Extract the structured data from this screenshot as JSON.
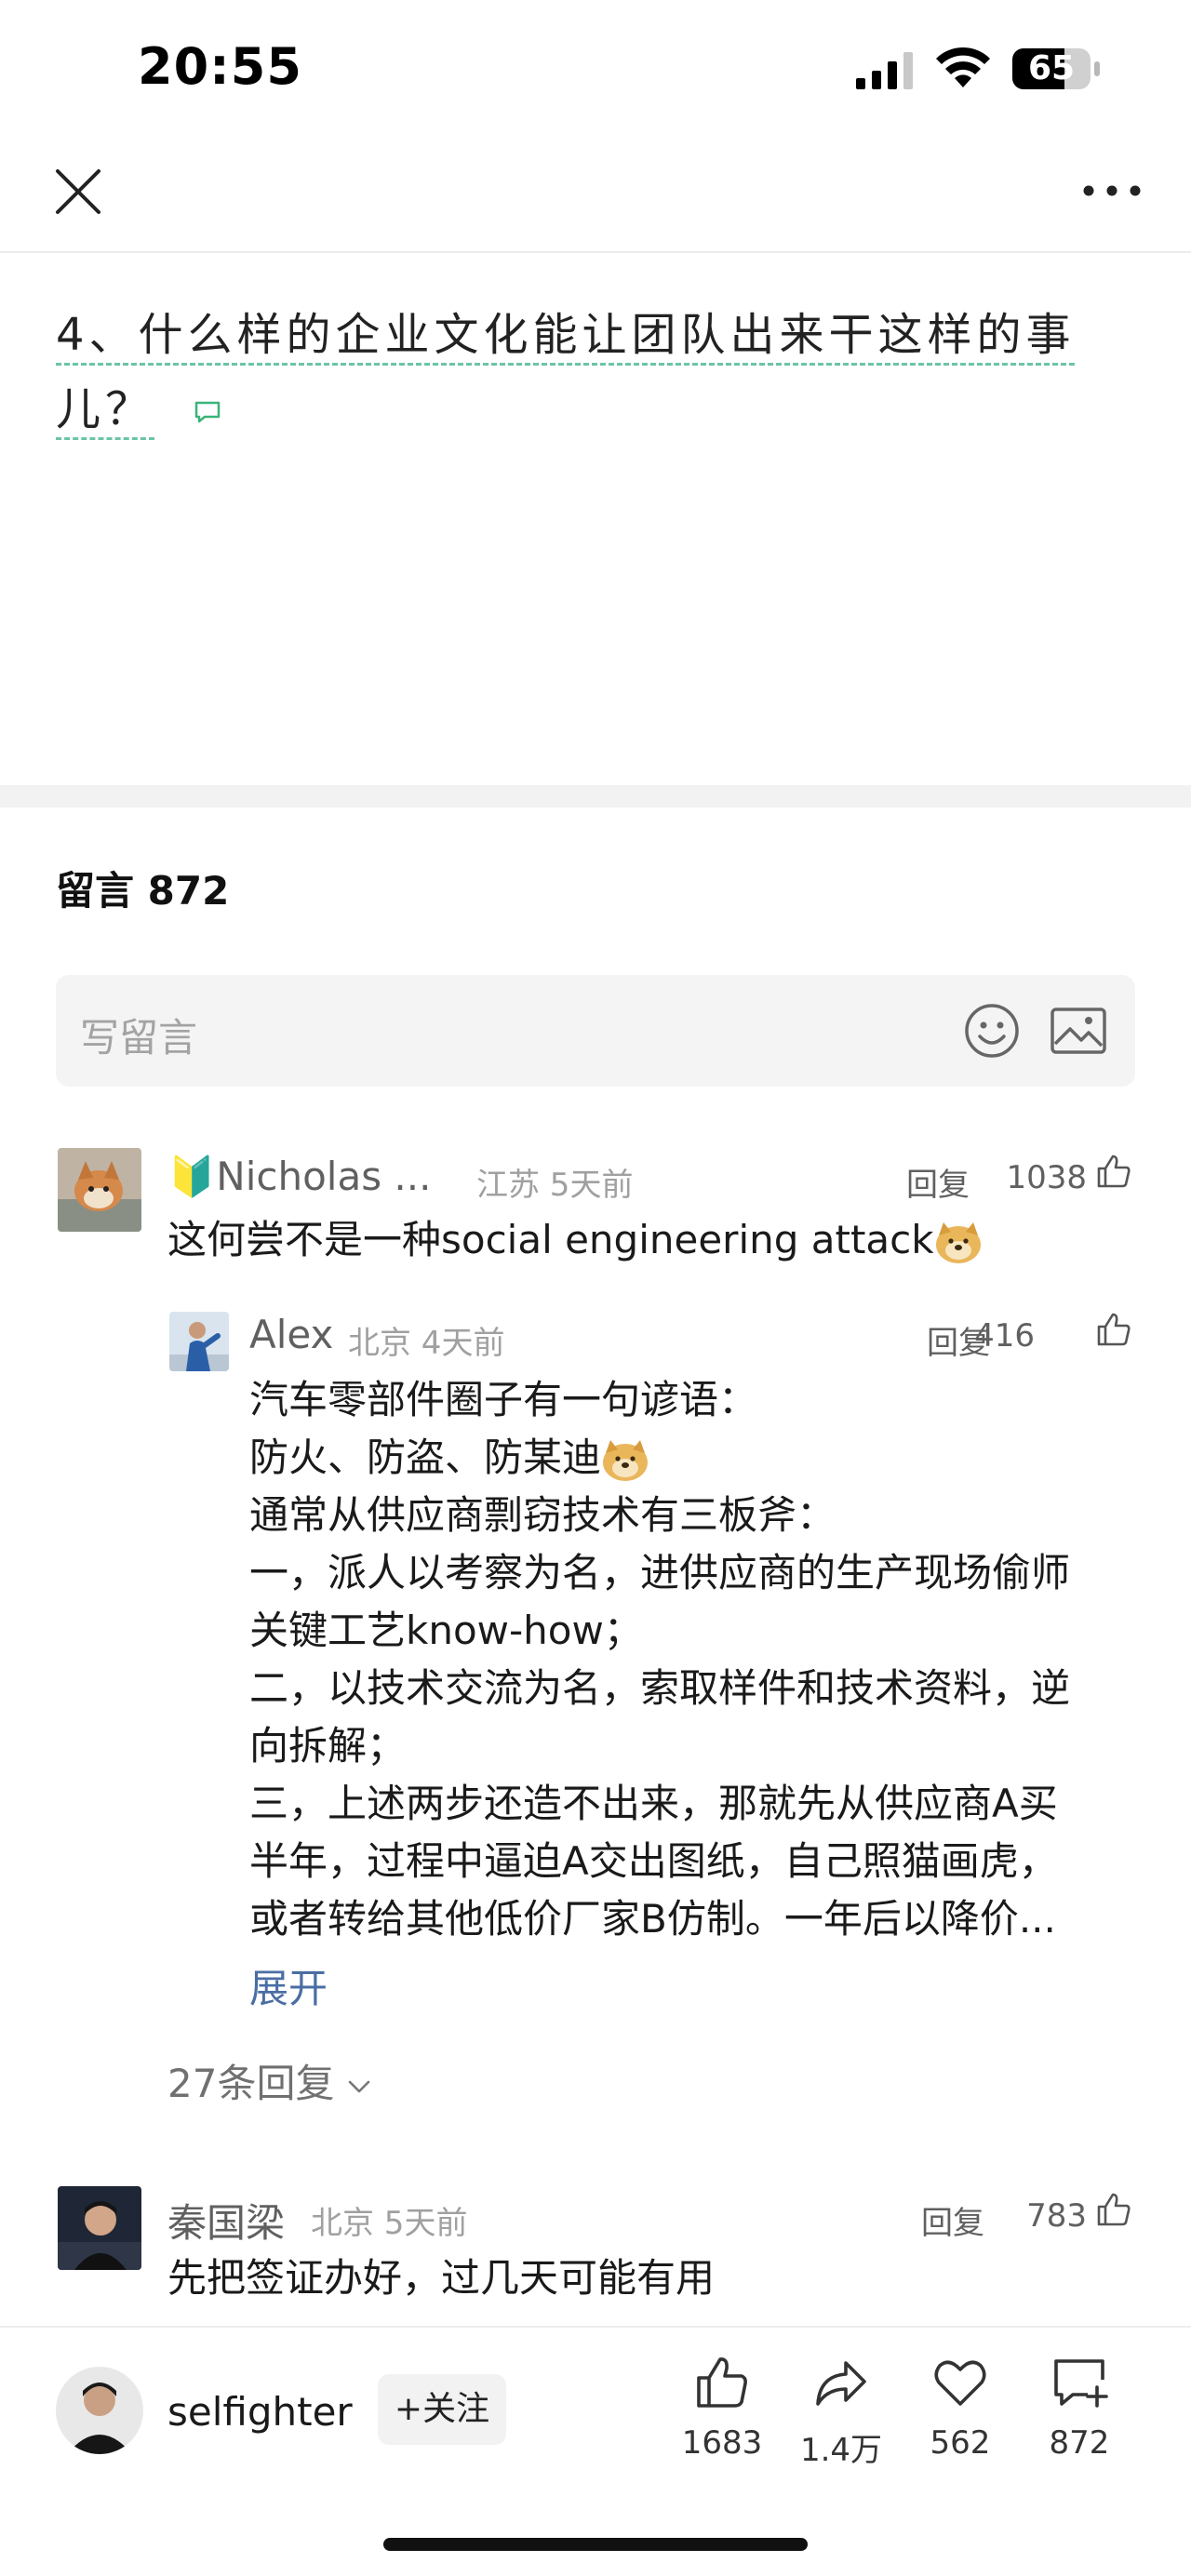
{
  "status_bar": {
    "time": "20:55",
    "battery": "65"
  },
  "article": {
    "line1": "4、什么样的企业文化能让团队出来干这样的事",
    "line2": "儿？"
  },
  "comments": {
    "header": "留言 872",
    "write_placeholder": "写留言",
    "items": [
      {
        "name": "🔰Nicholas ...",
        "meta": "江苏 5天前",
        "reply_label": "回复",
        "likes": "1038",
        "text": "这何尝不是一种social engineering attack"
      },
      {
        "name": "Alex",
        "meta": "北京 4天前",
        "reply_label": "回复",
        "likes": "416",
        "lines": [
          "汽车零部件圈子有一句谚语：",
          "防火、防盗、防某迪",
          "通常从供应商剽窃技术有三板斧：",
          "一，派人以考察为名，进供应商的生产现场偷师",
          "关键工艺know-how；",
          "二，以技术交流为名，索取样件和技术资料，逆",
          "向拆解；",
          "三，上述两步还造不出来，那就先从供应商A买",
          "半年，过程中逼迫A交出图纸，自己照猫画虎，",
          "或者转给其他低价厂家B仿制。一年后以降价..."
        ],
        "expand_label": "展开"
      },
      {
        "name": "秦国梁",
        "meta": "北京 5天前",
        "reply_label": "回复",
        "likes": "783",
        "text": "先把签证办好，过几天可能有用"
      }
    ],
    "replies_toggle": "27条回复"
  },
  "bottom_bar": {
    "author_name": "selfighter",
    "follow_label": "+关注",
    "actions": [
      {
        "icon": "thumbs-up-icon",
        "count": "1683"
      },
      {
        "icon": "share-icon",
        "count": "1.4万"
      },
      {
        "icon": "heart-icon",
        "count": "562"
      },
      {
        "icon": "comment-add-icon",
        "count": "872"
      }
    ]
  }
}
